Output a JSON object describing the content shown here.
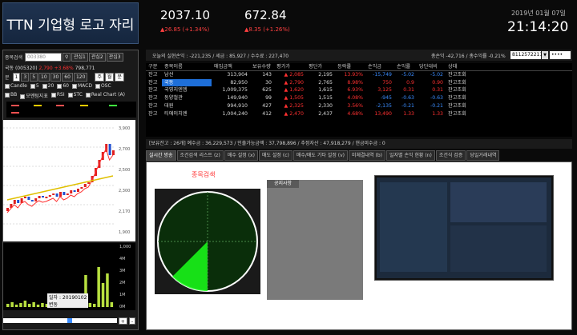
{
  "logo": "TTN 기업형 로고 자리",
  "indices": [
    {
      "value": "2037.10",
      "change": "▲26.85 (+1.34%)"
    },
    {
      "value": "672.84",
      "change": "▲8.35 (+1.26%)"
    }
  ],
  "date": "2019년 01월 07일",
  "time": "21:14:20",
  "left": {
    "search_label": "종목검색",
    "search_value": "003380",
    "btns": [
      "관심1",
      "관심2",
      "관심3"
    ],
    "stock_name": "국동",
    "stock_code": "(005320)",
    "price": "2,790",
    "pct": "+3.68%",
    "amount": "798,771",
    "periods": [
      "1",
      "3",
      "5",
      "10",
      "30",
      "60",
      "120"
    ],
    "period_boxes": [
      "주",
      "월",
      "분"
    ],
    "ind1": [
      "Candle",
      "5",
      "20",
      "60",
      "MACD",
      "OSC"
    ],
    "ind2": [
      "BB",
      "모멘텀지표",
      "RSI",
      "STC",
      "Real Chart (A)"
    ],
    "chart_labels": [
      "3,900",
      "2,700",
      "2,500",
      "2,300",
      "2,170",
      "1,900"
    ],
    "vol_labels": [
      "1,000",
      "4M",
      "3M",
      "2M",
      "1M",
      "0M"
    ],
    "tooltip_date": "일자 : 20190102",
    "tooltip_sub": "변동"
  },
  "acct": {
    "realized": "오늘의 실현손익 : -221,235 / 세금 : 85,927 / 수수료 : 227,470",
    "total": "총손익 -42,716 / 총수익률 -0.21%",
    "account_no": "8112572211",
    "password": "••••"
  },
  "table": {
    "headers": [
      "구분",
      "종목이름",
      "매입금액",
      "보유수량",
      "평가가",
      "평단가",
      "등락률",
      "손익금",
      "손익률",
      "당단대비",
      "상태"
    ],
    "rows": [
      [
        "잔고",
        "남선",
        "313,904",
        "143",
        "▲ 2,085",
        "2,195",
        "13.93%",
        "-15,749",
        "-5.02",
        "-5.02",
        "잔고조회"
      ],
      [
        "잔고",
        "국동",
        "82,950",
        "30",
        "▲ 2,790",
        "2,765",
        "8.98%",
        "750",
        "0.9",
        "0.90",
        "잔고조회"
      ],
      [
        "잔고",
        "국영지엔엠",
        "1,009,375",
        "625",
        "▲ 1,620",
        "1,615",
        "6.93%",
        "3,125",
        "0.31",
        "0.31",
        "잔고조회"
      ],
      [
        "잔고",
        "동양철관",
        "149,940",
        "99",
        "▲ 1,505",
        "1,515",
        "4.08%",
        "-945",
        "-0.63",
        "-0.63",
        "잔고조회"
      ],
      [
        "잔고",
        "대원",
        "994,910",
        "427",
        "▲ 2,325",
        "2,330",
        "3.56%",
        "-2,135",
        "-0.21",
        "-0.21",
        "잔고조회"
      ],
      [
        "잔고",
        "티에이치엔",
        "1,004,240",
        "412",
        "▲ 2,470",
        "2,437",
        "4.68%",
        "13,490",
        "1.33",
        "1.33",
        "잔고조회"
      ]
    ]
  },
  "status": "[보유잔고 : 26개]     예수금 : 36,229,573 / 인출가능금액 : 37,798,896 / 추정자산 : 47,918,279 / 현금미수금 : 0",
  "tabs": [
    "실시간 방송",
    "조건검색 리스트 (z)",
    "매수 설정 (x)",
    "매도 설정 (c)",
    "매수/매도 기타 설정 (v)",
    "미체결내역 (b)",
    "일자별 손익 현황 (n)",
    "조건식 검증",
    "당일거래내역"
  ],
  "panel": {
    "radar_title": "종목검색",
    "notice_title": "공지사항"
  },
  "colors": {
    "accent": "#ff3030",
    "down": "#3a8cff",
    "radar": "#1aff1a"
  }
}
